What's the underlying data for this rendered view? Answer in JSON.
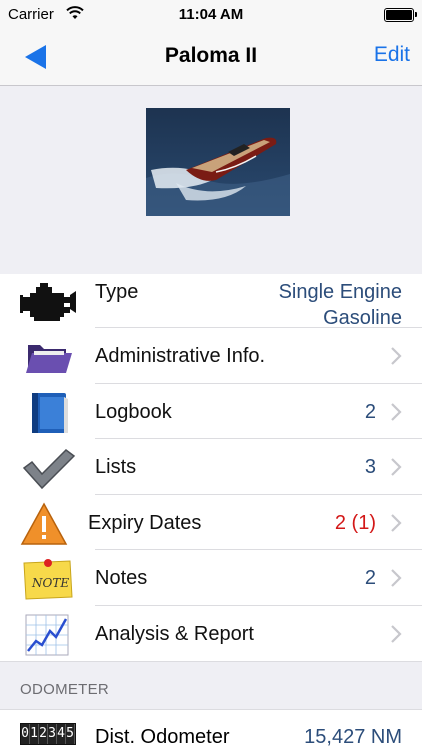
{
  "status": {
    "carrier": "Carrier",
    "time": "11:04 AM"
  },
  "nav": {
    "title": "Paloma II",
    "edit_label": "Edit"
  },
  "boat": {
    "type_label": "Type",
    "type_line1": "Single Engine",
    "type_line2": "Gasoline"
  },
  "rows": [
    {
      "label": "Administrative Info.",
      "value": "",
      "icon": "folder-icon"
    },
    {
      "label": "Logbook",
      "value": "2",
      "icon": "logbook-icon"
    },
    {
      "label": "Lists",
      "value": "3",
      "icon": "checkmark-icon"
    },
    {
      "label": "Expiry Dates",
      "value": "2 (1)",
      "icon": "warning-icon"
    },
    {
      "label": "Notes",
      "value": "2",
      "icon": "note-icon"
    },
    {
      "label": "Analysis & Report",
      "value": "",
      "icon": "chart-icon"
    }
  ],
  "odometer": {
    "section_title": "ODOMETER",
    "counter_digits": "012345",
    "label": "Dist. Odometer",
    "value": "15,427 NM"
  },
  "colors": {
    "accent": "#1a73e8",
    "value_text": "#2c4d7a",
    "alert": "#d31818"
  }
}
